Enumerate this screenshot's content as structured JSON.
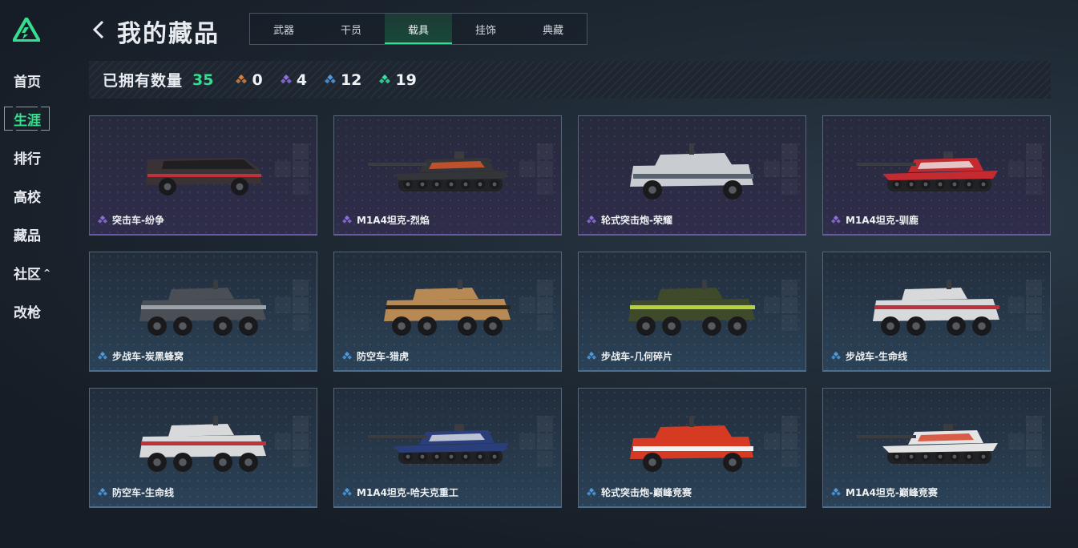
{
  "app": {
    "brand_color": "#34e08f"
  },
  "sidebar": {
    "items": [
      {
        "label": "首页",
        "name": "sidebar-item-home",
        "active": false
      },
      {
        "label": "生涯",
        "name": "sidebar-item-career",
        "active": true
      },
      {
        "label": "排行",
        "name": "sidebar-item-ranking",
        "active": false
      },
      {
        "label": "高校",
        "name": "sidebar-item-college",
        "active": false
      },
      {
        "label": "藏品",
        "name": "sidebar-item-collection",
        "active": false
      },
      {
        "label": "社区",
        "name": "sidebar-item-community",
        "active": false,
        "caret": "^"
      },
      {
        "label": "改枪",
        "name": "sidebar-item-gunsmith",
        "active": false
      }
    ]
  },
  "header": {
    "title": "我的藏品",
    "tabs": [
      {
        "label": "武器",
        "active": false
      },
      {
        "label": "干员",
        "active": false
      },
      {
        "label": "载具",
        "active": true
      },
      {
        "label": "挂饰",
        "active": false
      },
      {
        "label": "典藏",
        "active": false
      }
    ]
  },
  "stats": {
    "label": "已拥有数量",
    "total": "35",
    "rarities": [
      {
        "icon": "orange-gem-icon",
        "color": "#d9803b",
        "count": "0"
      },
      {
        "icon": "purple-gem-icon",
        "color": "#8e6fe0",
        "count": "4"
      },
      {
        "icon": "blue-gem-icon",
        "color": "#4f9be0",
        "count": "12"
      },
      {
        "icon": "green-gem-icon",
        "color": "#34e0a0",
        "count": "19"
      }
    ]
  },
  "cards": [
    {
      "name": "突击车-纷争",
      "rarity": "purple",
      "vehicle": "assault-car-icon",
      "body": "#3a3234",
      "accent": "#c0323a"
    },
    {
      "name": "M1A4坦克-烈焰",
      "rarity": "purple",
      "vehicle": "tank-icon",
      "body": "#333538",
      "accent": "#e0582a"
    },
    {
      "name": "轮式突击炮-荣耀",
      "rarity": "purple",
      "vehicle": "wheeled-gun-icon",
      "body": "#c9cdd2",
      "accent": "#5a6470"
    },
    {
      "name": "M1A4坦克-驯鹿",
      "rarity": "purple",
      "vehicle": "tank-icon",
      "body": "#c42a30",
      "accent": "#eeeeee"
    },
    {
      "name": "步战车-炭黑蜂窝",
      "rarity": "blue",
      "vehicle": "apc-icon",
      "body": "#4a4f55",
      "accent": "#9aa2aa"
    },
    {
      "name": "防空车-猎虎",
      "rarity": "blue",
      "vehicle": "apc-icon",
      "body": "#b78a55",
      "accent": "#2b2520"
    },
    {
      "name": "步战车-几何碎片",
      "rarity": "blue",
      "vehicle": "apc-icon",
      "body": "#3f4a2a",
      "accent": "#b5d23a"
    },
    {
      "name": "步战车-生命线",
      "rarity": "blue",
      "vehicle": "apc-icon",
      "body": "#d8d9db",
      "accent": "#c0323a"
    },
    {
      "name": "防空车-生命线",
      "rarity": "blue",
      "vehicle": "apc-icon",
      "body": "#d8d9db",
      "accent": "#c0323a"
    },
    {
      "name": "M1A4坦克-哈夫克重工",
      "rarity": "blue",
      "vehicle": "tank-icon",
      "body": "#2b3e7c",
      "accent": "#dfe3ea"
    },
    {
      "name": "轮式突击炮-巅峰竞赛",
      "rarity": "blue",
      "vehicle": "wheeled-gun-icon",
      "body": "#d63a22",
      "accent": "#f2f2f2"
    },
    {
      "name": "M1A4坦克-巅峰竞赛",
      "rarity": "blue",
      "vehicle": "tank-icon",
      "body": "#e4e4e4",
      "accent": "#d63a22"
    }
  ]
}
